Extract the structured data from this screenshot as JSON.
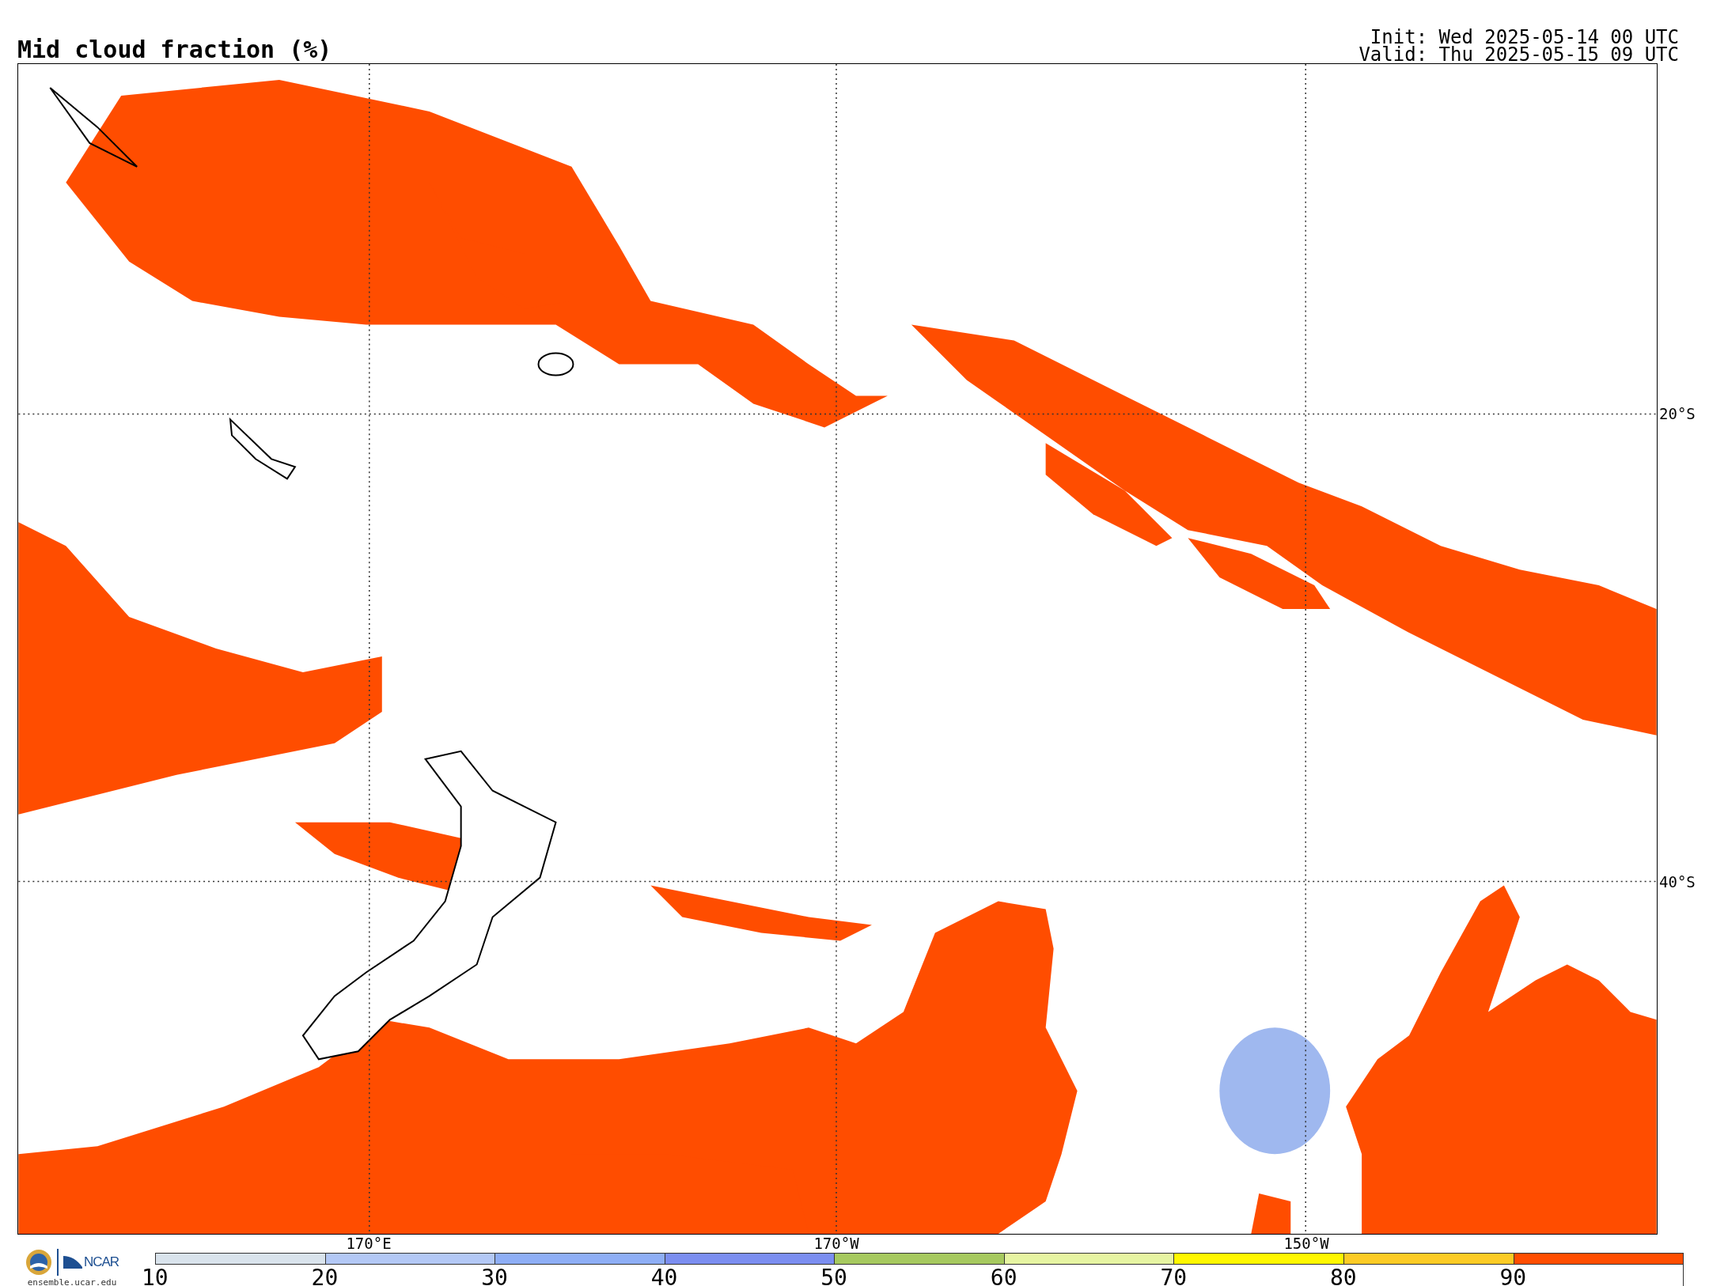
{
  "title": "Mid cloud fraction (%)",
  "times": {
    "init": "Init: Wed 2025-05-14 00 UTC",
    "valid": "Valid: Thu 2025-05-15 09 UTC"
  },
  "map": {
    "meridians": [
      {
        "label": "170°E"
      },
      {
        "label": "170°W"
      },
      {
        "label": "150°W"
      }
    ],
    "parallels": [
      {
        "label": "20°S"
      },
      {
        "label": "40°S"
      }
    ]
  },
  "footer": {
    "logo_text": "NCAR",
    "site": "ensemble.ucar.edu"
  },
  "colorbar": {
    "segments": [
      {
        "label": "10",
        "color": "#d9e3ec"
      },
      {
        "label": "20",
        "color": "#b3c8f5"
      },
      {
        "label": "30",
        "color": "#8eaef5"
      },
      {
        "label": "40",
        "color": "#7b8ef0"
      },
      {
        "label": "50",
        "color": "#a6c95f"
      },
      {
        "label": "60",
        "color": "#e6f4a2"
      },
      {
        "label": "70",
        "color": "#fff700"
      },
      {
        "label": "80",
        "color": "#fccb25"
      },
      {
        "label": "90",
        "color": "#ff4d00"
      }
    ]
  }
}
